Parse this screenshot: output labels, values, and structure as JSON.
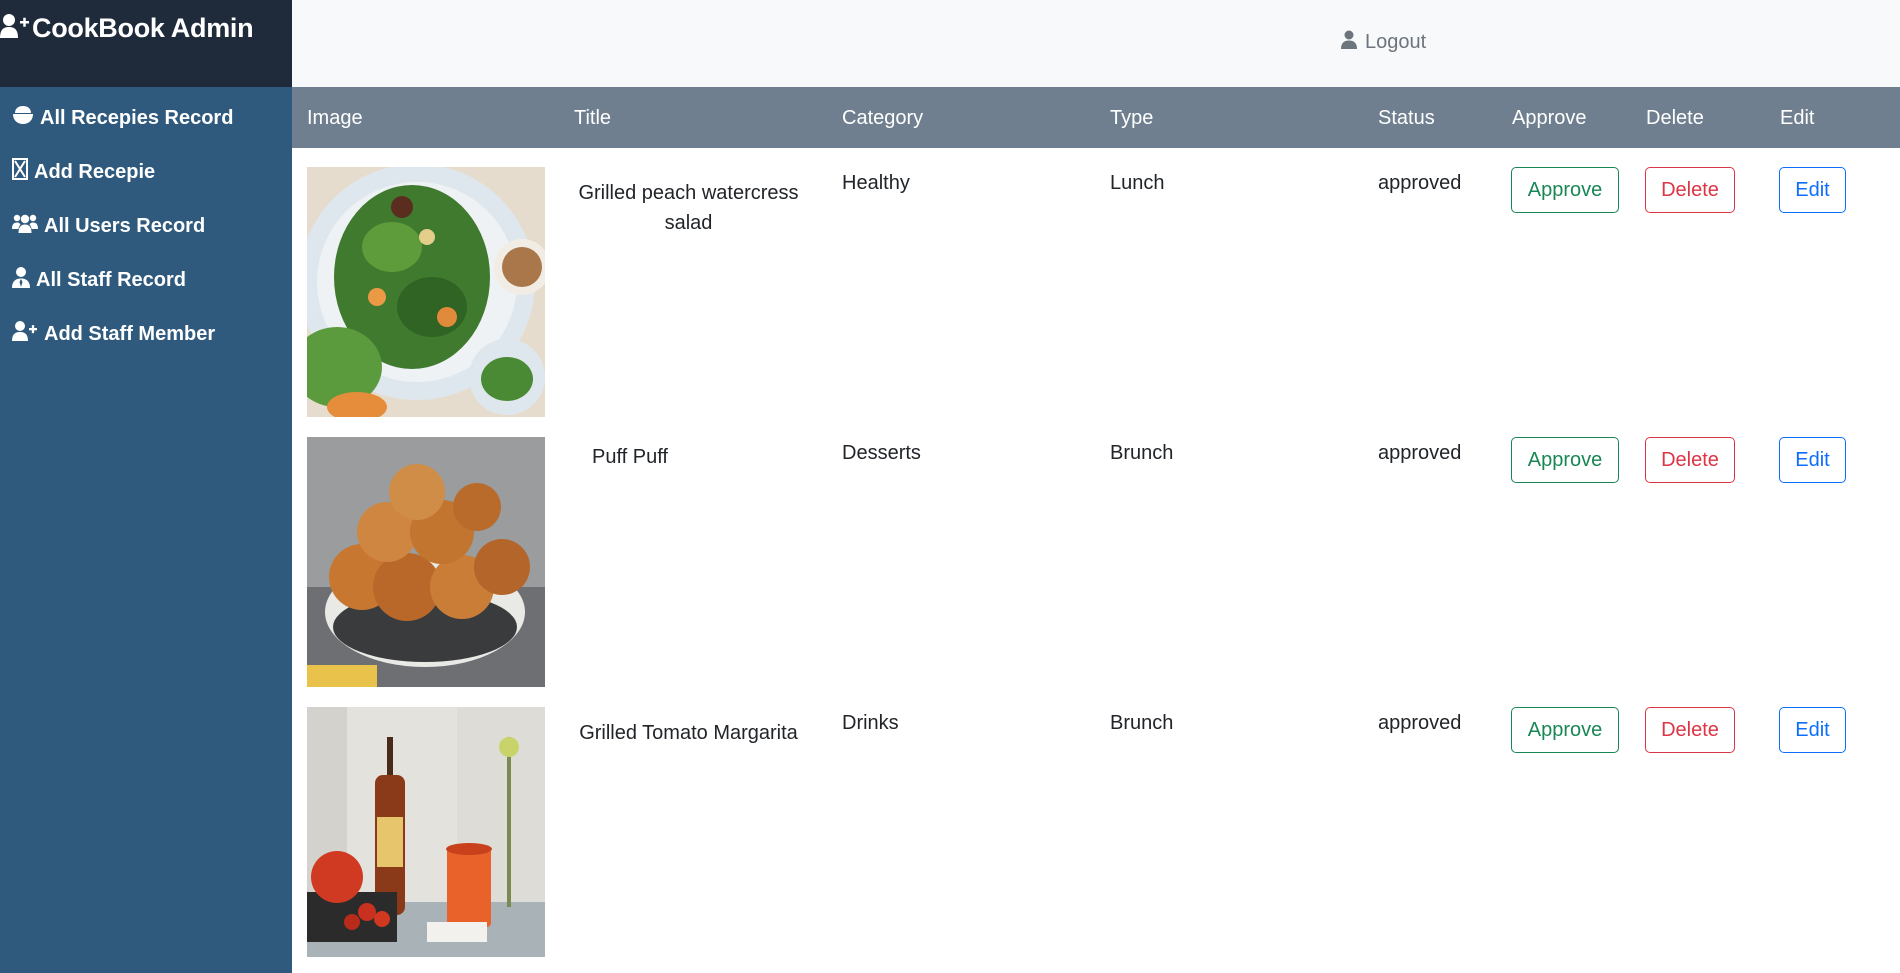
{
  "brand": {
    "title": "CookBook Admin",
    "icon": "user-plus-icon"
  },
  "topbar": {
    "logout_label": "Logout",
    "logout_icon": "user-icon"
  },
  "sidebar": {
    "items": [
      {
        "label": "All Recepies Record",
        "icon": "bowl-icon"
      },
      {
        "label": "Add Recepie",
        "icon": "hourglass-icon"
      },
      {
        "label": "All Users Record",
        "icon": "users-icon"
      },
      {
        "label": "All Staff Record",
        "icon": "staff-icon"
      },
      {
        "label": "Add Staff Member",
        "icon": "user-plus-icon"
      }
    ]
  },
  "table": {
    "headers": [
      "Image",
      "Title",
      "Category",
      "Type",
      "Status",
      "Approve",
      "Delete",
      "Edit"
    ],
    "rows": [
      {
        "title": "Grilled peach watercress salad",
        "category": "Healthy",
        "type": "Lunch",
        "status": "approved",
        "approve": "Approve",
        "delete": "Delete",
        "edit": "Edit"
      },
      {
        "title": "Puff Puff",
        "category": "Desserts",
        "type": "Brunch",
        "status": "approved",
        "approve": "Approve",
        "delete": "Delete",
        "edit": "Edit"
      },
      {
        "title": "Grilled Tomato Margarita",
        "category": "Drinks",
        "type": "Brunch",
        "status": "approved",
        "approve": "Approve",
        "delete": "Delete",
        "edit": "Edit"
      }
    ]
  },
  "colors": {
    "sidebar": "#2f5a7d",
    "brand_bg": "#1f2a3a",
    "header_bg": "#6f7f8f",
    "approve": "#198754",
    "delete": "#dc3545",
    "edit": "#0d6efd"
  }
}
